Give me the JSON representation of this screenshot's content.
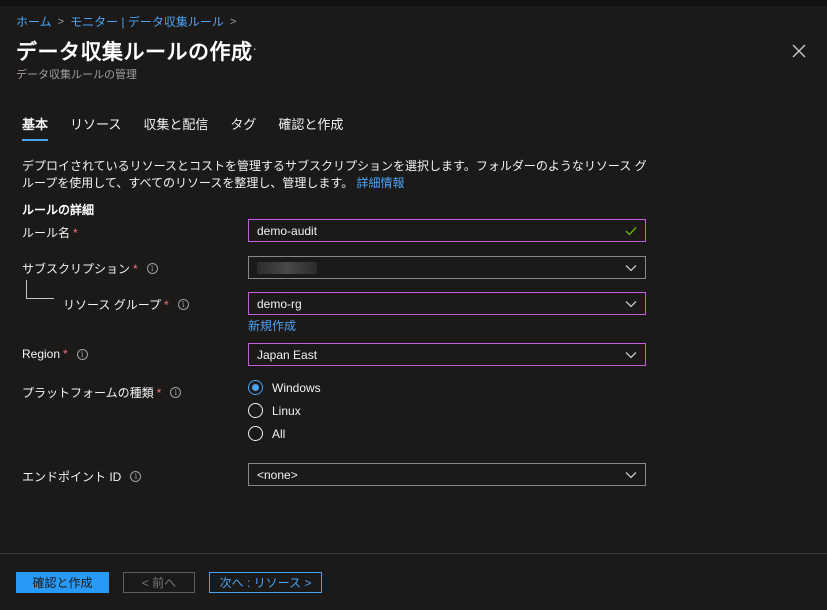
{
  "breadcrumb": [
    "ホーム",
    "モニター | データ収集ルール"
  ],
  "title": "データ収集ルールの作成",
  "more": "···",
  "subtitle": "データ収集ルールの管理",
  "tabs": [
    "基本",
    "リソース",
    "収集と配信",
    "タグ",
    "確認と作成"
  ],
  "description": {
    "text": "デプロイされているリソースとコストを管理するサブスクリプションを選択します。フォルダーのようなリソース グループを使用して、すべてのリソースを整理し、管理します。",
    "link": "詳細情報"
  },
  "section_title": "ルールの詳細",
  "fields": {
    "rule_name": {
      "label": "ルール名",
      "value": "demo-audit"
    },
    "subscription": {
      "label": "サブスクリプション",
      "value": ""
    },
    "resource_group": {
      "label": "リソース グループ",
      "value": "demo-rg",
      "create_new": "新規作成"
    },
    "region": {
      "label": "Region",
      "value": "Japan East"
    },
    "platform": {
      "label": "プラットフォームの種類",
      "options": [
        "Windows",
        "Linux",
        "All"
      ],
      "selected": "Windows"
    },
    "endpoint": {
      "label": "エンドポイント ID",
      "value": "<none>"
    }
  },
  "info_glyph": "i",
  "required_mark": "*",
  "buttons": {
    "review": "確認と作成",
    "prev": "< 前へ",
    "next": "次へ : リソース >"
  },
  "colors": {
    "accent": "#4ba3f5",
    "focus_border": "#c35fdc",
    "primary_button": "#2899f5",
    "required": "#f1707b"
  }
}
